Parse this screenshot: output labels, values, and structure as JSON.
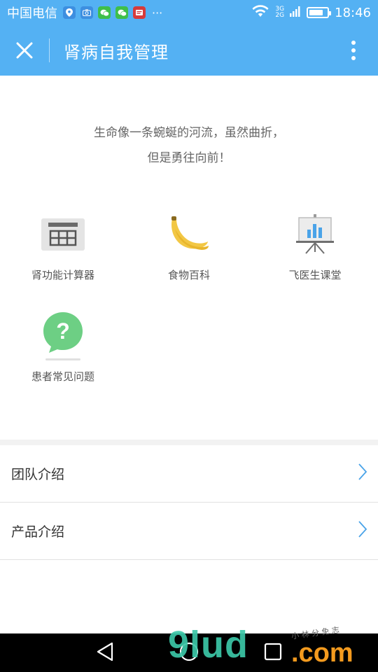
{
  "status_bar": {
    "carrier": "中国电信",
    "overflow": "···",
    "net_top": "3G",
    "net_bottom": "2G",
    "battery_level": 0.8,
    "time": "18:46",
    "notification_icons": [
      "map-pin-icon",
      "camera-icon",
      "wechat-icon",
      "wechat-icon",
      "app-icon"
    ]
  },
  "app_bar": {
    "title": "肾病自我管理",
    "close_icon": "close-icon",
    "more_icon": "more-vertical-icon",
    "color": "#54b1f3"
  },
  "slogan": {
    "line1": "生命像一条蜿蜒的河流，虽然曲折，",
    "line2": "但是勇往向前！"
  },
  "grid": [
    {
      "label": "肾功能计算器",
      "icon": "calculator-icon"
    },
    {
      "label": "食物百科",
      "icon": "banana-icon"
    },
    {
      "label": "飞医生课堂",
      "icon": "presentation-board-icon"
    },
    {
      "label": "患者常见问题",
      "icon": "question-bubble-icon"
    }
  ],
  "list": [
    {
      "label": "团队介绍",
      "icon": "chevron-right-icon"
    },
    {
      "label": "产品介绍",
      "icon": "chevron-right-icon"
    }
  ],
  "nav_bar": {
    "back_icon": "back-triangle-icon",
    "home_icon": "home-circle-icon",
    "recents_icon": "recents-square-icon"
  },
  "watermark": {
    "text": "9lud",
    "suffix": ".com",
    "small": "小 林 分 免 志"
  }
}
